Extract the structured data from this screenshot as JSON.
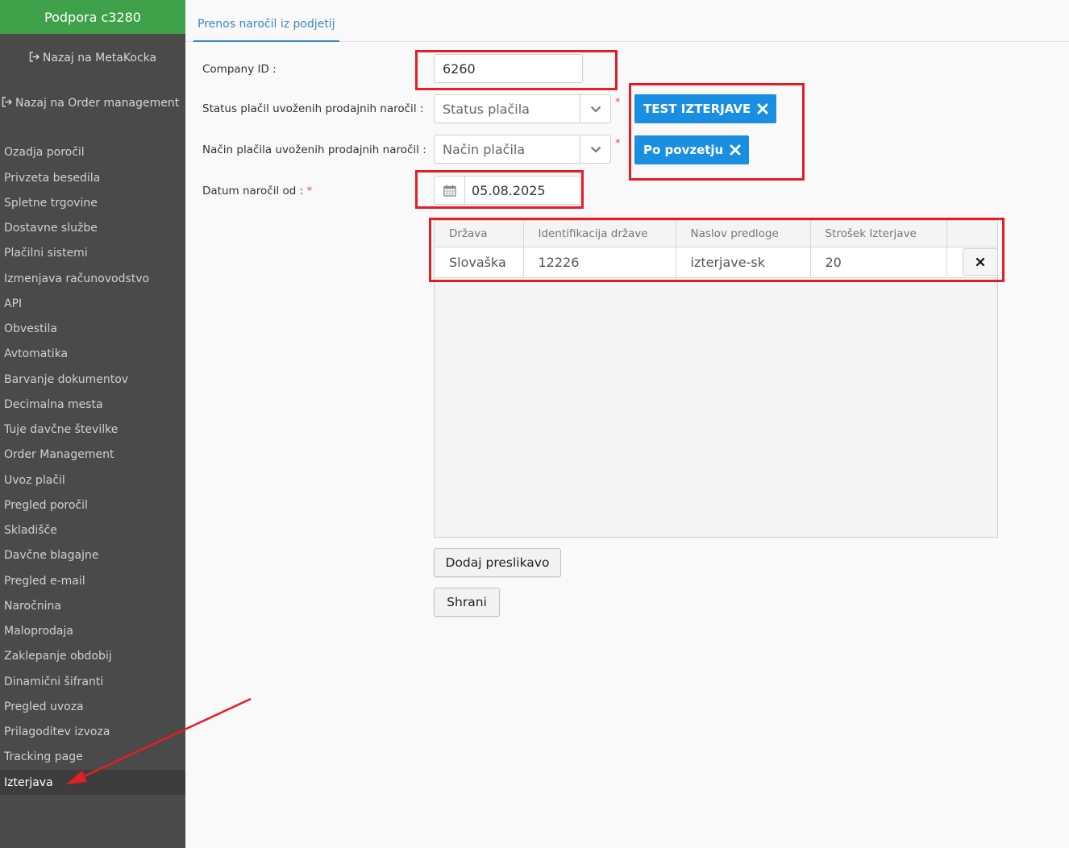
{
  "sidebar": {
    "title": "Podpora c3280",
    "back_links": [
      {
        "label": "Nazaj na MetaKocka"
      },
      {
        "label": "Nazaj na Order management"
      }
    ],
    "items": [
      {
        "label": "Ozadja poročil"
      },
      {
        "label": "Privzeta besedila"
      },
      {
        "label": "Spletne trgovine"
      },
      {
        "label": "Dostavne službe"
      },
      {
        "label": "Plačilni sistemi"
      },
      {
        "label": "Izmenjava računovodstvo"
      },
      {
        "label": "API"
      },
      {
        "label": "Obvestila"
      },
      {
        "label": "Avtomatika"
      },
      {
        "label": "Barvanje dokumentov"
      },
      {
        "label": "Decimalna mesta"
      },
      {
        "label": "Tuje davčne številke"
      },
      {
        "label": "Order Management"
      },
      {
        "label": "Uvoz plačil"
      },
      {
        "label": "Pregled poročil"
      },
      {
        "label": "Skladišče"
      },
      {
        "label": "Davčne blagajne"
      },
      {
        "label": "Pregled e-mail"
      },
      {
        "label": "Naročnina"
      },
      {
        "label": "Maloprodaja"
      },
      {
        "label": "Zaklepanje obdobij"
      },
      {
        "label": "Dinamični šifranti"
      },
      {
        "label": "Pregled uvoza"
      },
      {
        "label": "Prilagoditev izvoza"
      },
      {
        "label": "Tracking page"
      },
      {
        "label": "Izterjava",
        "active": true
      }
    ]
  },
  "tabs": {
    "active_label": "Prenos naročil iz podjetij"
  },
  "form": {
    "company_id": {
      "label": "Company ID :",
      "value": "6260"
    },
    "payment_status": {
      "label": "Status plačil uvoženih prodajnih naročil :",
      "placeholder": "Status plačila",
      "required_mark": "*",
      "selected_tag": "TEST IZTERJAVE"
    },
    "payment_method": {
      "label": "Način plačila uvoženih prodajnih naročil :",
      "placeholder": "Način plačila",
      "required_mark": "*",
      "selected_tag": "Po povzetju"
    },
    "order_date": {
      "label": "Datum naročil od :",
      "required_mark": "*",
      "value": "05.08.2025"
    }
  },
  "mapping_table": {
    "headers": [
      "Država",
      "Identifikacija države",
      "Naslov predloge",
      "Strošek Izterjave"
    ],
    "rows": [
      {
        "country": "Slovaška",
        "country_id": "12226",
        "template_title": "izterjave-sk",
        "cost": "20"
      }
    ]
  },
  "buttons": {
    "add_mapping": "Dodaj preslikavo",
    "save": "Shrani"
  },
  "colors": {
    "sidebar_bg": "#4a4a4a",
    "sidebar_header": "#3fa24a",
    "accent": "#3a87c6",
    "tag_bg": "#1a8ee1",
    "annotation_red": "#e31e24"
  },
  "icons": {
    "back": "sign-out-icon",
    "chevron": "chevron-down-icon",
    "calendar": "calendar-icon",
    "remove": "close-icon"
  }
}
